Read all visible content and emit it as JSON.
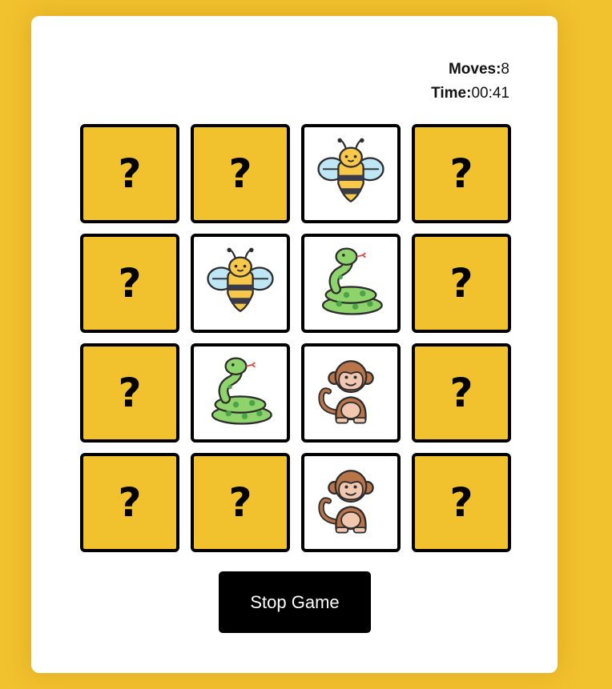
{
  "stats": {
    "moves_label": "Moves:",
    "moves_value": "8",
    "time_label": "Time:",
    "time_value": "00:41"
  },
  "cards": [
    {
      "state": "hidden",
      "symbol": "?"
    },
    {
      "state": "hidden",
      "symbol": "?"
    },
    {
      "state": "flipped",
      "icon": "bee-icon"
    },
    {
      "state": "hidden",
      "symbol": "?"
    },
    {
      "state": "hidden",
      "symbol": "?"
    },
    {
      "state": "flipped",
      "icon": "bee-icon"
    },
    {
      "state": "flipped",
      "icon": "snake-icon"
    },
    {
      "state": "hidden",
      "symbol": "?"
    },
    {
      "state": "hidden",
      "symbol": "?"
    },
    {
      "state": "flipped",
      "icon": "snake-icon"
    },
    {
      "state": "flipped",
      "icon": "monkey-icon"
    },
    {
      "state": "hidden",
      "symbol": "?"
    },
    {
      "state": "hidden",
      "symbol": "?"
    },
    {
      "state": "hidden",
      "symbol": "?"
    },
    {
      "state": "flipped",
      "icon": "monkey-icon"
    },
    {
      "state": "hidden",
      "symbol": "?"
    }
  ],
  "controls": {
    "stop_label": "Stop Game"
  },
  "colors": {
    "background": "#f2c12e",
    "card_back": "#f2c12e",
    "card_face": "#ffffff",
    "button": "#000000"
  }
}
